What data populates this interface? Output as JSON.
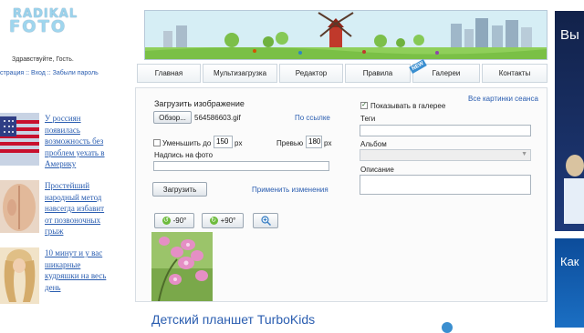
{
  "header": {
    "logo_line1": "RADIKAL",
    "logo_line2": "FOTO"
  },
  "user": {
    "greeting": "Здравствуйте, Гость.",
    "links_text": "страция :: Вход :: Забыли пароль"
  },
  "news": [
    {
      "text": "У россиян появилась возможность без проблем уехать в Америку"
    },
    {
      "text": "Простейший народный метод навсегда избавит от позвоночных грыж"
    },
    {
      "text": "10 минут и у вас шикарные кудряшки на весь день"
    }
  ],
  "nav": {
    "tabs": [
      {
        "label": "Главная"
      },
      {
        "label": "Мультизагрузка"
      },
      {
        "label": "Редактор"
      },
      {
        "label": "Правила"
      },
      {
        "label": "Галереи"
      },
      {
        "label": "Контакты"
      }
    ],
    "new_badge": "NEW"
  },
  "upload": {
    "title": "Загрузить изображение",
    "browse_label": "Обзор...",
    "filename": "564586603.gif",
    "by_link": "По ссылке",
    "reduce_label": "Уменьшить до",
    "reduce_value": "150",
    "reduce_unit": "px",
    "preview_label": "Превью",
    "preview_value": "180",
    "preview_unit": "px",
    "caption_label": "Надпись на фото",
    "caption_value": "",
    "submit_label": "Загрузить",
    "apply_link": "Применить изменения",
    "rotate_left": "-90°",
    "rotate_right": "+90°"
  },
  "gallery": {
    "all_images_link": "Все картинки сеанса",
    "show_in_gallery_label": "Показывать в галерее",
    "show_in_gallery_checked": true,
    "tags_label": "Теги",
    "tags_value": "",
    "album_label": "Альбом",
    "album_value": "",
    "description_label": "Описание",
    "description_value": ""
  },
  "ads": {
    "right_top_text": "Вы",
    "right_bottom_text": "Как"
  },
  "footer_ad": {
    "title": "Детский планшет TurboKids"
  }
}
